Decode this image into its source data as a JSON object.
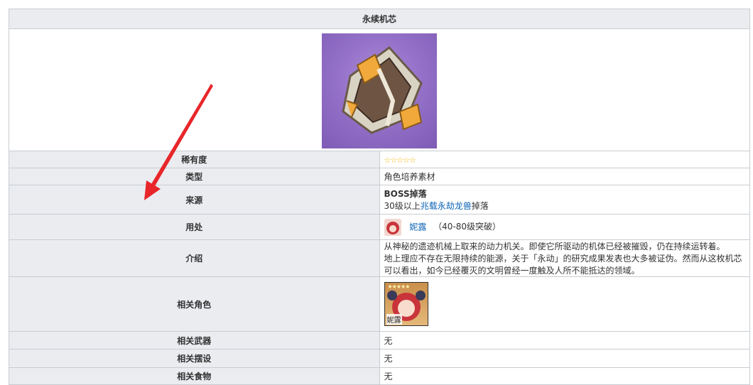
{
  "item": {
    "title": "永续机芯",
    "image_icon": "eternal-mechanism-icon"
  },
  "rows": {
    "rarity": {
      "label": "稀有度",
      "value": "☆☆☆☆☆"
    },
    "type": {
      "label": "类型",
      "value": "角色培养素材"
    },
    "source": {
      "label": "来源",
      "line1": "BOSS掉落",
      "line2_prefix": "30级以上",
      "line2_link": "兆载永劫龙兽",
      "line2_suffix": "掉落"
    },
    "usage": {
      "label": "用处",
      "character_link": "妮露",
      "detail": "（40-80级突破）"
    },
    "description": {
      "label": "介绍",
      "line1": "从神秘的遗迹机械上取来的动力机关。即使它所驱动的机体已经被摧毁，仍在持续运转着。",
      "line2": "地上理应不存在无限持续的能源，关于「永动」的研究成果发表也大多被证伪。然而从这枚机芯可以看出，如今已经覆灭的文明曾经一度触及人所不能抵达的领域。"
    },
    "related_characters": {
      "label": "相关角色",
      "card_name": "妮露",
      "card_stars": "★★★★★"
    },
    "related_weapons": {
      "label": "相关武器",
      "value": "无"
    },
    "related_furnishings": {
      "label": "相关摆设",
      "value": "无"
    },
    "cut_row": {
      "label": "相关食物",
      "value": "无"
    }
  },
  "colors": {
    "header_bg": "#eaecf0",
    "border": "#c8ccd1",
    "link": "#0b63b5",
    "arrow": "#e8262a"
  }
}
